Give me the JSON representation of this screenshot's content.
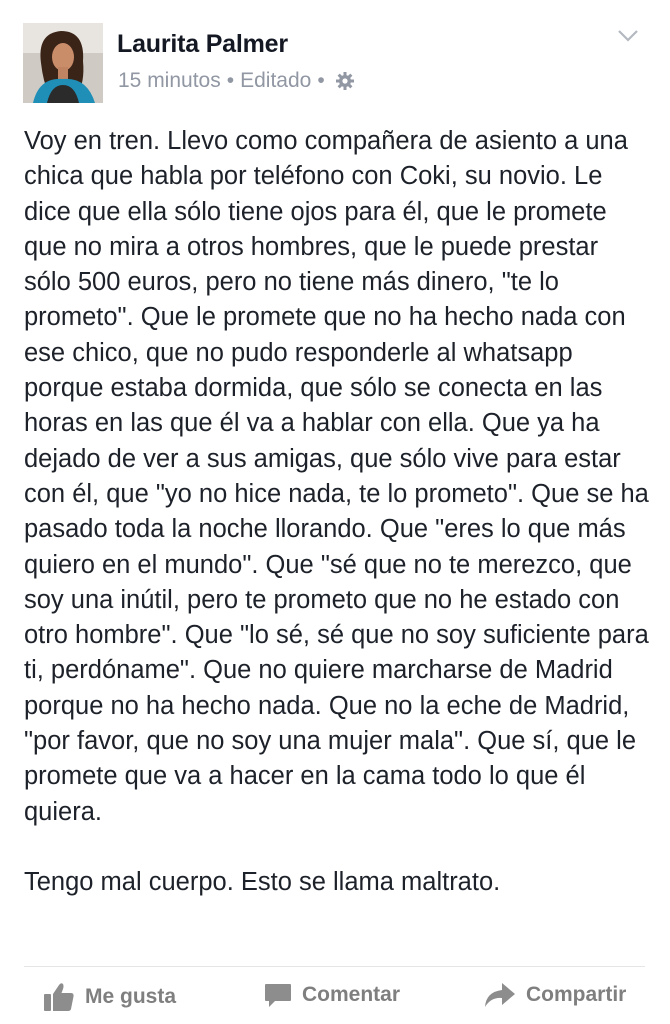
{
  "post": {
    "author": "Laurita Palmer",
    "time": "15 minutos",
    "edited": "Editado",
    "separator": "•",
    "paragraphs": [
      "Voy en tren. Llevo como compañera de asiento a una chica que habla por teléfono con Coki, su novio. Le dice que ella sólo tiene ojos para él, que le promete que no mira a otros hombres, que le puede prestar sólo 500 euros, pero no tiene más dinero, \"te lo prometo\". Que le promete que no ha hecho nada con ese chico, que no pudo responderle al whatsapp porque estaba dormida, que sólo se conecta en las horas en las que él va a hablar con ella. Que ya ha dejado de ver a sus amigas, que sólo vive para estar con él, que \"yo no hice nada, te lo prometo\". Que se ha pasado toda la noche llorando. Que \"eres lo que más quiero en el mundo\". Que \"sé que no te merezco, que soy una inútil, pero te prometo que no he estado con otro hombre\". Que \"lo sé, sé que no soy suficiente para ti, perdóname\". Que no quiere marcharse de Madrid porque no ha hecho nada. Que no la eche de Madrid, \"por favor, que no soy una mujer mala\". Que sí, que le promete que va a hacer en la cama todo lo que él quiera.",
      "Tengo mal cuerpo. Esto se llama maltrato."
    ]
  },
  "actions": {
    "like": "Me gusta",
    "comment": "Comentar",
    "share": "Compartir"
  },
  "icons": {
    "privacy": "gear-icon",
    "menu": "chevron-down-icon",
    "like": "thumbs-up-icon",
    "comment": "speech-bubble-icon",
    "share": "share-arrow-icon"
  },
  "colors": {
    "name": "#141823",
    "meta": "#9197a3",
    "action": "#7f7f7f",
    "text": "#1d2129"
  }
}
